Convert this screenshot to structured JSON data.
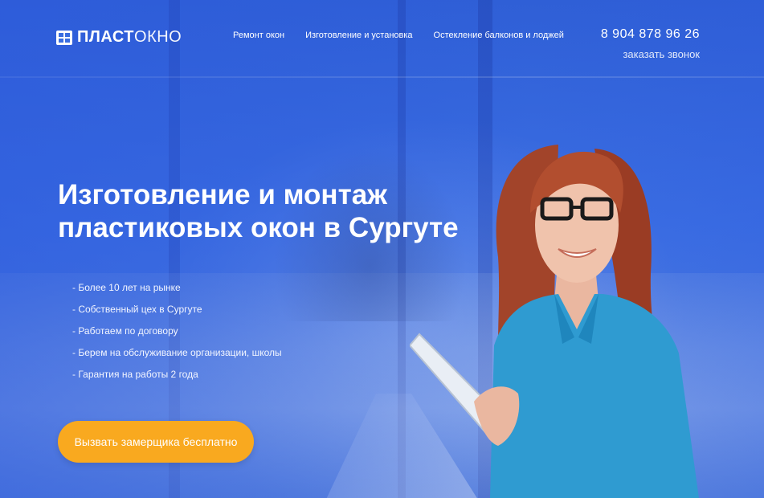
{
  "brand": {
    "logo_part1": "ПЛАСТ",
    "logo_part2": "ОКНО"
  },
  "nav": {
    "items": [
      {
        "label": "Ремонт окон"
      },
      {
        "label": "Изготовление и установка"
      },
      {
        "label": "Остекление балконов и лоджей"
      }
    ]
  },
  "contact": {
    "phone": "8 904 878 96 26",
    "callback": "заказать звонок"
  },
  "hero": {
    "title_line1": "Изготовление и монтаж",
    "title_line2": "пластиковых окон в Сургуте",
    "features": [
      "- Более 10 лет на рынке",
      "- Собственный цех в Сургуте",
      "- Работаем по договору",
      "- Берем на обслуживание организации, школы",
      "- Гарантия на работы 2 года"
    ],
    "cta_label": "Вызвать замерщика бесплатно"
  },
  "colors": {
    "background": "#3a6ee0",
    "cta": "#f9a91f",
    "text": "#ffffff"
  },
  "icons": {
    "logo": "window-icon"
  }
}
